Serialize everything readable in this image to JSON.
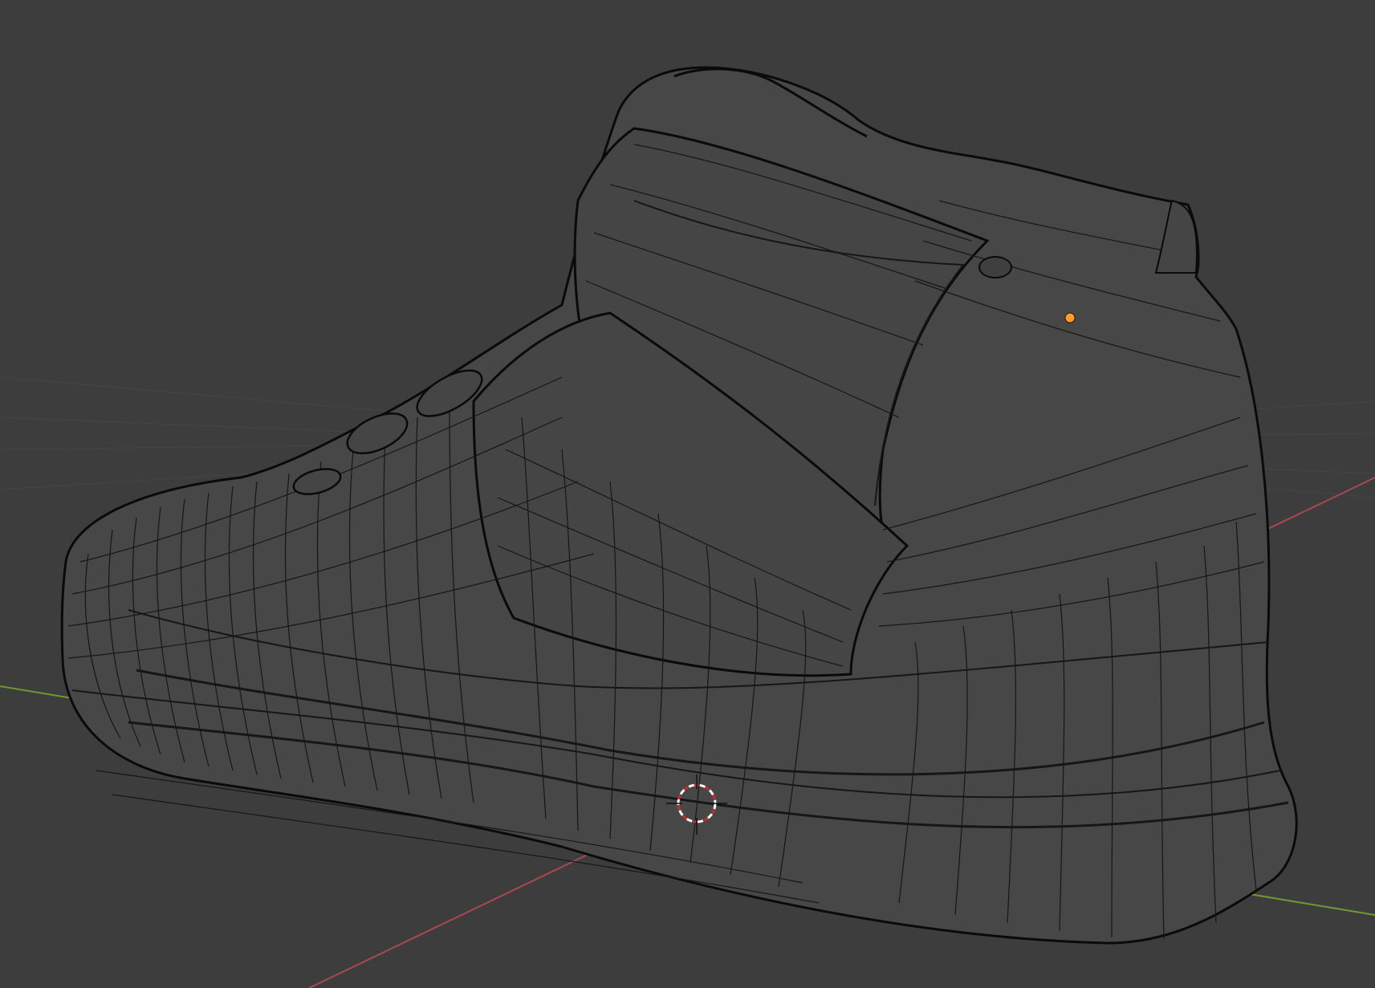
{
  "app": {
    "name": "3D Viewport",
    "mode": "wireframe",
    "object": "sneaker-mesh"
  },
  "colors": {
    "background": "#3d3d3d",
    "grid": "#474747",
    "x_axis": "#a8484f",
    "y_axis": "#6f9a2f",
    "wire": "#161616",
    "wire_outline": "#0a0a0a",
    "shade": "#474747",
    "origin": "#ff9d2a",
    "cursor_red": "#cc2a2a",
    "cursor_white": "#ffffff"
  },
  "icons": {
    "object_origin": "origin-dot-icon",
    "cursor": "3d-cursor-icon"
  }
}
